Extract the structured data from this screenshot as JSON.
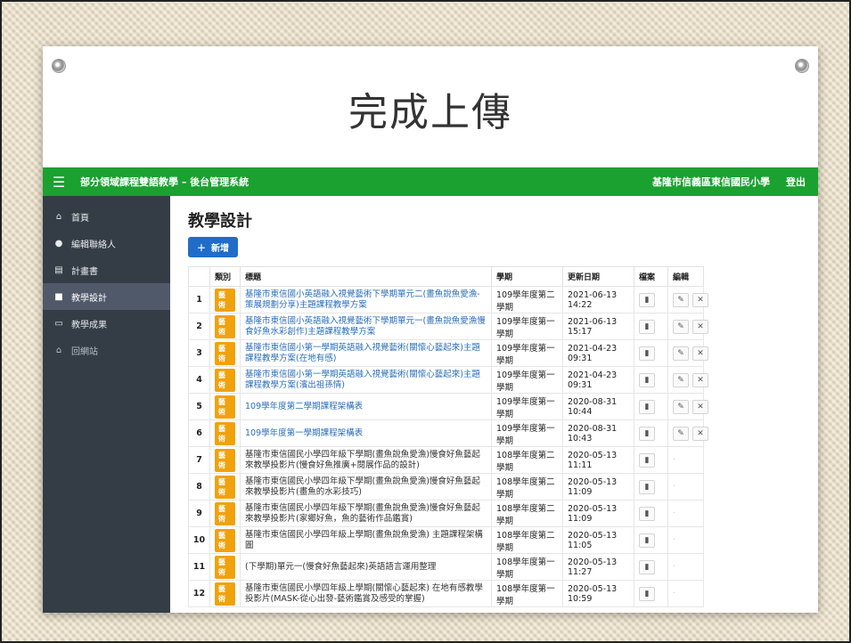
{
  "slide": {
    "title": "完成上傳"
  },
  "topbar": {
    "menu_icon": "hamburger-icon",
    "brand": "部分領域課程雙語教學 – 後台管理系統",
    "school": "基隆市信義區東信國民小學",
    "logout": "登出"
  },
  "sidebar": {
    "items": [
      {
        "icon": "home-icon",
        "glyph": "⌂",
        "label": "首頁",
        "active": false
      },
      {
        "icon": "user-icon",
        "glyph": "●",
        "label": "編輯聯絡人",
        "active": false
      },
      {
        "icon": "document-icon",
        "glyph": "▤",
        "label": "計畫書",
        "active": false
      },
      {
        "icon": "file-icon",
        "glyph": "■",
        "label": "教學設計",
        "active": true
      },
      {
        "icon": "image-icon",
        "glyph": "▭",
        "label": "教學成果",
        "active": false
      },
      {
        "icon": "home-icon",
        "glyph": "⌂",
        "label": "回網站",
        "active": false
      }
    ]
  },
  "main": {
    "page_title": "教學設計",
    "add_button": "新增",
    "columns": [
      "",
      "類別",
      "標題",
      "學期",
      "更新日期",
      "檔案",
      "編輯"
    ],
    "rows": [
      {
        "no": "1",
        "tag": "藝術",
        "title": "基隆市東信國小英語融入視覺藝術下學期單元二(畫魚說魚愛漁-策展規劃分享)主題課程教學方案",
        "semester": "109學年度第二學期",
        "date": "2021-06-13 14:22",
        "link": true,
        "editable": true
      },
      {
        "no": "2",
        "tag": "藝術",
        "title": "基隆市東信國小英語融入視覺藝術下學期單元一(畫魚說魚愛漁慢食好魚水彩創作)主題課程教學方案",
        "semester": "109學年度第一學期",
        "date": "2021-06-13 15:17",
        "link": true,
        "editable": true
      },
      {
        "no": "3",
        "tag": "藝術",
        "title": "基隆市東信國小第一學期英語融入視覺藝術(關懷心藝起來)主題課程教學方案(在地有感)",
        "semester": "109學年度第一學期",
        "date": "2021-04-23 09:31",
        "link": true,
        "editable": true
      },
      {
        "no": "4",
        "tag": "藝術",
        "title": "基隆市東信國小第一學期英語融入視覺藝術(關懷心藝起來)主題課程教學方案(濱出祖孫情)",
        "semester": "109學年度第一學期",
        "date": "2021-04-23 09:31",
        "link": true,
        "editable": true
      },
      {
        "no": "5",
        "tag": "藝術",
        "title": "109學年度第二學期課程架構表",
        "semester": "109學年度第一學期",
        "date": "2020-08-31 10:44",
        "link": true,
        "editable": true
      },
      {
        "no": "6",
        "tag": "藝術",
        "title": "109學年度第一學期課程架構表",
        "semester": "109學年度第一學期",
        "date": "2020-08-31 10:43",
        "link": true,
        "editable": true
      },
      {
        "no": "7",
        "tag": "藝術",
        "title": "基隆市東信國民小學四年級下學期(畫魚說魚愛漁)慢食好魚藝起來教學投影片(慢食好魚推廣+閱展作品的設計)",
        "semester": "108學年度第二學期",
        "date": "2020-05-13 11:11",
        "link": false,
        "editable": false
      },
      {
        "no": "8",
        "tag": "藝術",
        "title": "基隆市東信國民小學四年級下學期(畫魚說魚愛漁)慢食好魚藝起來教學投影片(畫魚的水彩技巧)",
        "semester": "108學年度第二學期",
        "date": "2020-05-13 11:09",
        "link": false,
        "editable": false
      },
      {
        "no": "9",
        "tag": "藝術",
        "title": "基隆市東信國民小學四年級下學期(畫魚說魚愛漁)慢食好魚藝起來教學投影片(家鄉好魚，魚的藝術作品鑑賞)",
        "semester": "108學年度第二學期",
        "date": "2020-05-13 11:09",
        "link": false,
        "editable": false
      },
      {
        "no": "10",
        "tag": "藝術",
        "title": "基隆市東信國民小學四年級上學期(畫魚說魚愛漁) 主題課程架構圖",
        "semester": "108學年度第二學期",
        "date": "2020-05-13 11:05",
        "link": false,
        "editable": false
      },
      {
        "no": "11",
        "tag": "藝術",
        "title": "(下學期)單元一(慢食好魚藝起來)英語語言運用整理",
        "semester": "108學年度第一學期",
        "date": "2020-05-13 11:27",
        "link": false,
        "editable": false
      },
      {
        "no": "12",
        "tag": "藝術",
        "title": "基隆市東信國民小學四年級上學期(關懷心藝起來) 在地有感教學投影片(MASK-從心出發-藝術鑑賞及感受的掌握)",
        "semester": "108學年度第一學期",
        "date": "2020-05-13 10:59",
        "link": false,
        "editable": false
      }
    ]
  },
  "icons": {
    "file": "file-icon",
    "edit": "edit-icon",
    "delete": "close-icon",
    "add": "plus-icon"
  },
  "colors": {
    "topbar": "#1aa12f",
    "sidebar": "#343d46",
    "badge": "#f0a20c",
    "link": "#2a6ebb",
    "button": "#1f6dc9"
  }
}
